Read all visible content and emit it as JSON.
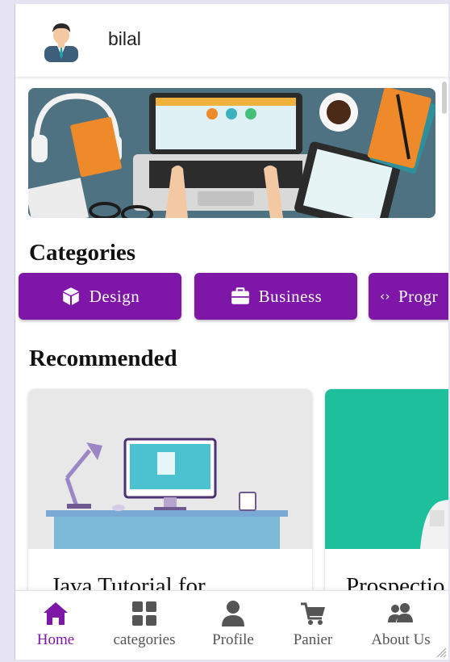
{
  "header": {
    "username": "bilal"
  },
  "colors": {
    "accent": "#7e16a8",
    "nav_inactive": "#555555"
  },
  "categories": {
    "title": "Categories",
    "items": [
      {
        "label": "Design",
        "icon": "cube-icon"
      },
      {
        "label": "Business",
        "icon": "briefcase-icon"
      },
      {
        "label": "Progr",
        "icon": "code-icon"
      }
    ]
  },
  "recommended": {
    "title": "Recommended",
    "cards": [
      {
        "title": "Java Tutorial for"
      },
      {
        "title": "Prospectio"
      }
    ]
  },
  "bottom_nav": {
    "items": [
      {
        "label": "Home",
        "icon": "home-icon",
        "active": true
      },
      {
        "label": "categories",
        "icon": "grid-icon",
        "active": false
      },
      {
        "label": "Profile",
        "icon": "user-icon",
        "active": false
      },
      {
        "label": "Panier",
        "icon": "cart-icon",
        "active": false
      },
      {
        "label": "About Us",
        "icon": "users-icon",
        "active": false
      }
    ]
  }
}
